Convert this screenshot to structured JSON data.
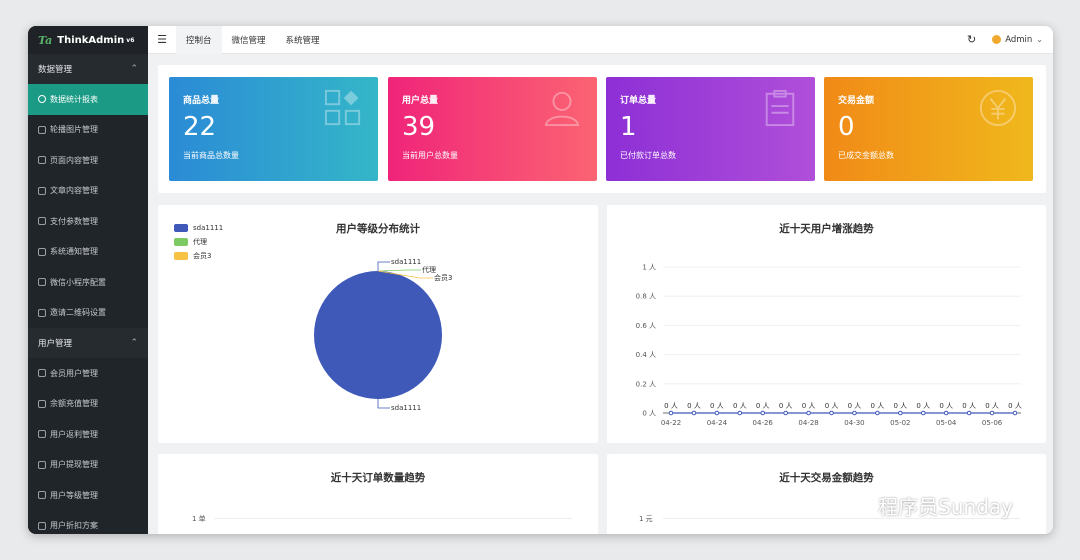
{
  "app": {
    "logo_mark": "Ta",
    "title": "ThinkAdmin",
    "version": "v6"
  },
  "sidebar": {
    "group1": "数据管理",
    "items1": [
      {
        "label": "数据统计报表",
        "icon": "chart-icon",
        "active": true
      },
      {
        "label": "轮播图片管理",
        "icon": "image-icon"
      },
      {
        "label": "页面内容管理",
        "icon": "page-icon"
      },
      {
        "label": "文章内容管理",
        "icon": "article-icon"
      },
      {
        "label": "支付参数管理",
        "icon": "payment-icon"
      },
      {
        "label": "系统通知管理",
        "icon": "bell-icon"
      },
      {
        "label": "微信小程序配置",
        "icon": "miniapp-icon"
      },
      {
        "label": "邀请二维码设置",
        "icon": "qrcode-icon"
      }
    ],
    "group2": "用户管理",
    "items2": [
      {
        "label": "会员用户管理",
        "icon": "user-icon"
      },
      {
        "label": "余额充值管理",
        "icon": "balance-icon"
      },
      {
        "label": "用户返利管理",
        "icon": "rebate-icon"
      },
      {
        "label": "用户提现管理",
        "icon": "withdraw-icon"
      },
      {
        "label": "用户等级管理",
        "icon": "level-icon"
      },
      {
        "label": "用户折扣方案",
        "icon": "discount-icon"
      }
    ]
  },
  "topbar": {
    "menu_icon": "☰",
    "tabs": [
      "控制台",
      "微信管理",
      "系统管理"
    ],
    "refresh_icon": "↻",
    "user": "Admin"
  },
  "stats": [
    {
      "title": "商品总量",
      "value": "22",
      "sub": "当前商品总数量",
      "icon": "grid-icon"
    },
    {
      "title": "用户总量",
      "value": "39",
      "sub": "当前用户总数量",
      "icon": "user-icon"
    },
    {
      "title": "订单总量",
      "value": "1",
      "sub": "已付款订单总数",
      "icon": "clipboard-icon"
    },
    {
      "title": "交易金额",
      "value": "0",
      "sub": "已成交金额总数",
      "icon": "yen-icon"
    }
  ],
  "chart_data": [
    {
      "type": "pie",
      "title": "用户等级分布统计",
      "categories": [
        "sda1111",
        "代理",
        "会员3"
      ],
      "values": [
        100,
        0,
        0
      ],
      "colors": [
        "#3f59b9",
        "#7ccb62",
        "#f6c244"
      ],
      "legend": "top-left"
    },
    {
      "type": "line",
      "title": "近十天用户增涨趋势",
      "x": [
        "04-22",
        "04-23",
        "04-24",
        "04-25",
        "04-26",
        "04-27",
        "04-28",
        "04-29",
        "04-30",
        "05-01",
        "05-02",
        "05-03",
        "05-04",
        "05-05",
        "05-06",
        "05-07"
      ],
      "xticks": [
        "04-22",
        "04-24",
        "04-26",
        "04-28",
        "04-30",
        "05-02",
        "05-04",
        "05-06"
      ],
      "values": [
        0,
        0,
        0,
        0,
        0,
        0,
        0,
        0,
        0,
        0,
        0,
        0,
        0,
        0,
        0,
        0
      ],
      "point_label": "0 人",
      "yticks": [
        "0 人",
        "0.2 人",
        "0.4 人",
        "0.6 人",
        "0.8 人",
        "1 人"
      ],
      "ylim": [
        0,
        1
      ],
      "grid": true,
      "color": "#3f59b9"
    },
    {
      "type": "line",
      "title": "近十天订单数量趋势",
      "ytick_top": "1 单"
    },
    {
      "type": "line",
      "title": "近十天交易金额趋势",
      "ytick_top": "1 元"
    }
  ],
  "watermark": "程序员Sunday"
}
